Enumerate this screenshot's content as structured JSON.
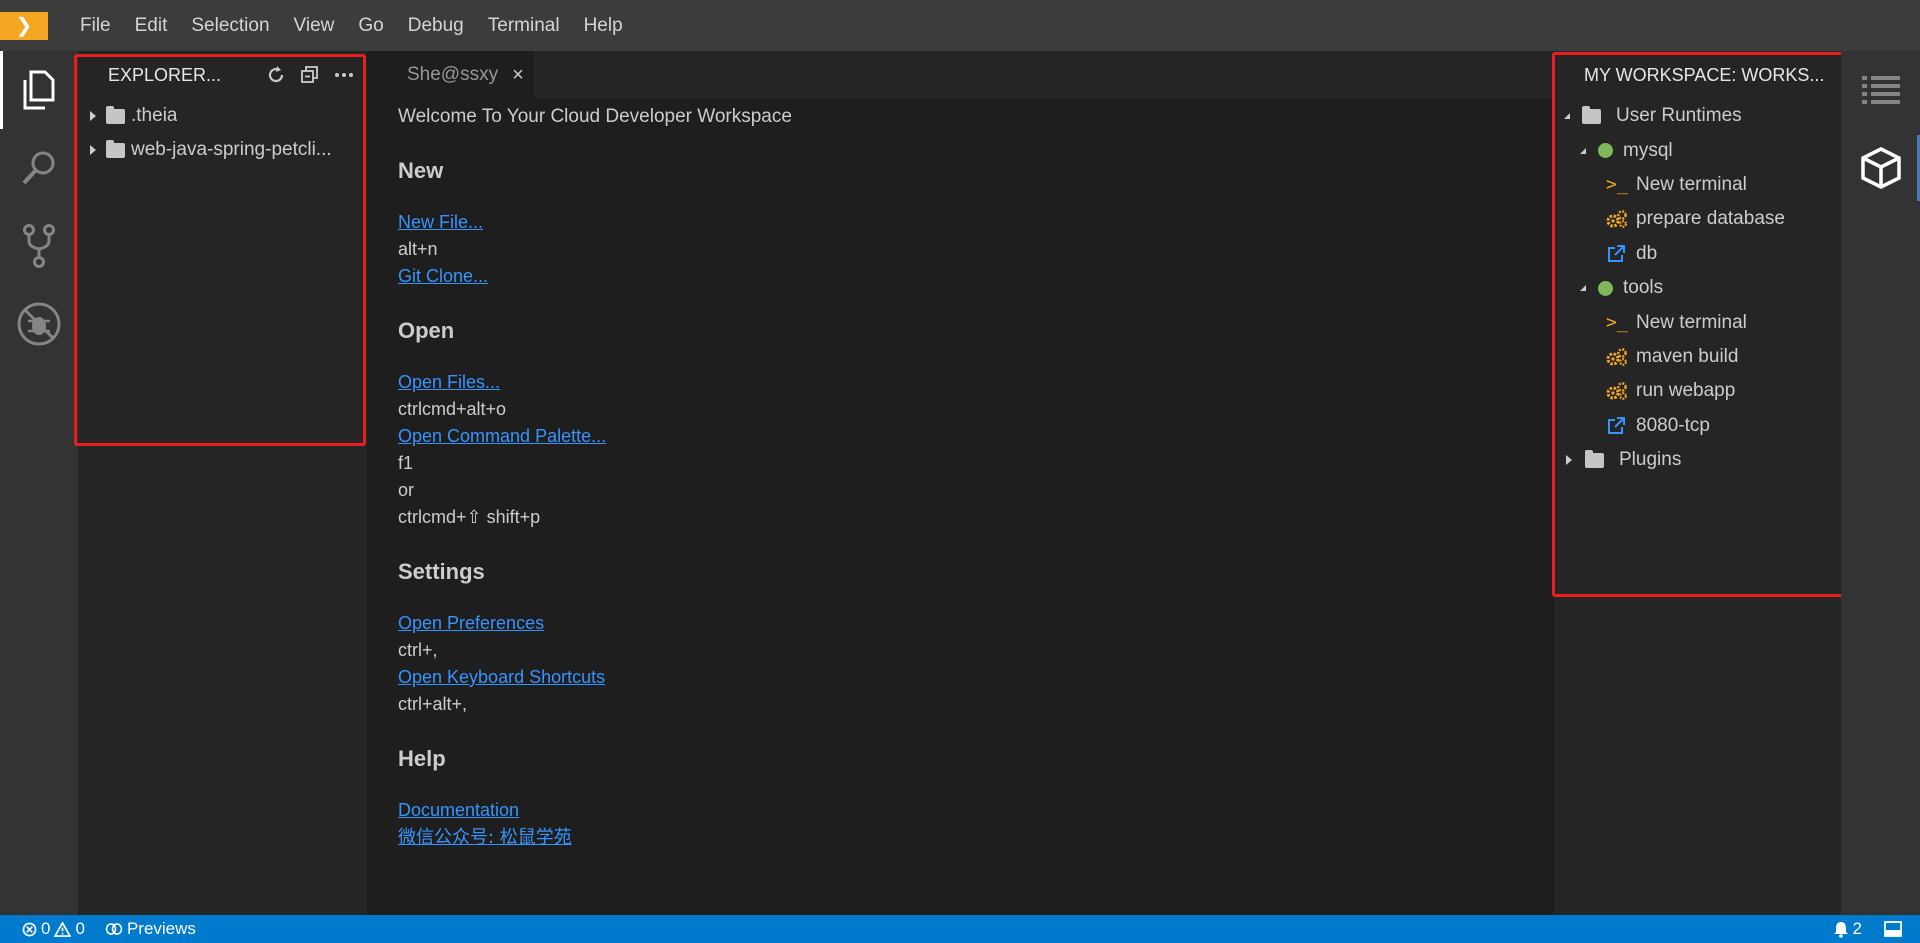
{
  "menubar": {
    "items": [
      "File",
      "Edit",
      "Selection",
      "View",
      "Go",
      "Debug",
      "Terminal",
      "Help"
    ]
  },
  "activity_bar": {
    "icons": [
      "files-icon",
      "search-icon",
      "source-control-icon",
      "debug-icon"
    ]
  },
  "explorer": {
    "title": "EXPLORER...",
    "items": [
      {
        "label": ".theia"
      },
      {
        "label": "web-java-spring-petcli..."
      }
    ]
  },
  "editor": {
    "tab": {
      "label": "She@ssxy",
      "close": "×"
    },
    "welcome": {
      "title": "Welcome To Your Cloud Developer Workspace",
      "new_heading": "New",
      "new_file": "New File...",
      "new_file_key": "alt+n",
      "git_clone": "Git Clone...",
      "open_heading": "Open",
      "open_files": "Open Files...",
      "open_files_key": "ctrlcmd+alt+o",
      "open_command_palette": "Open Command Palette...",
      "command_key_1": "f1",
      "command_or": "or",
      "command_key_2": "ctrlcmd+⇧ shift+p",
      "settings_heading": "Settings",
      "open_preferences": "Open Preferences",
      "preferences_key": "ctrl+,",
      "open_keyboard_shortcuts": "Open Keyboard Shortcuts",
      "shortcuts_key": "ctrl+alt+,",
      "help_heading": "Help",
      "documentation": "Documentation",
      "wechat": "微信公众号: 松鼠学苑"
    }
  },
  "workspace": {
    "title": "MY WORKSPACE: WORKS...",
    "user_runtimes": "User Runtimes",
    "mysql": {
      "label": "mysql",
      "items": [
        "New terminal",
        "prepare database",
        "db"
      ]
    },
    "tools": {
      "label": "tools",
      "items": [
        "New terminal",
        "maven build",
        "run webapp",
        "8080-tcp"
      ]
    },
    "plugins": "Plugins",
    "status_color": "#7fb85a",
    "accent_color": "#f5a623"
  },
  "statusbar": {
    "errors": "0",
    "warnings": "0",
    "previews": "Previews",
    "notifications": "2"
  },
  "colors": {
    "status_bar": "#007acc",
    "link": "#3794ff",
    "highlight_box": "#e81f1f"
  }
}
